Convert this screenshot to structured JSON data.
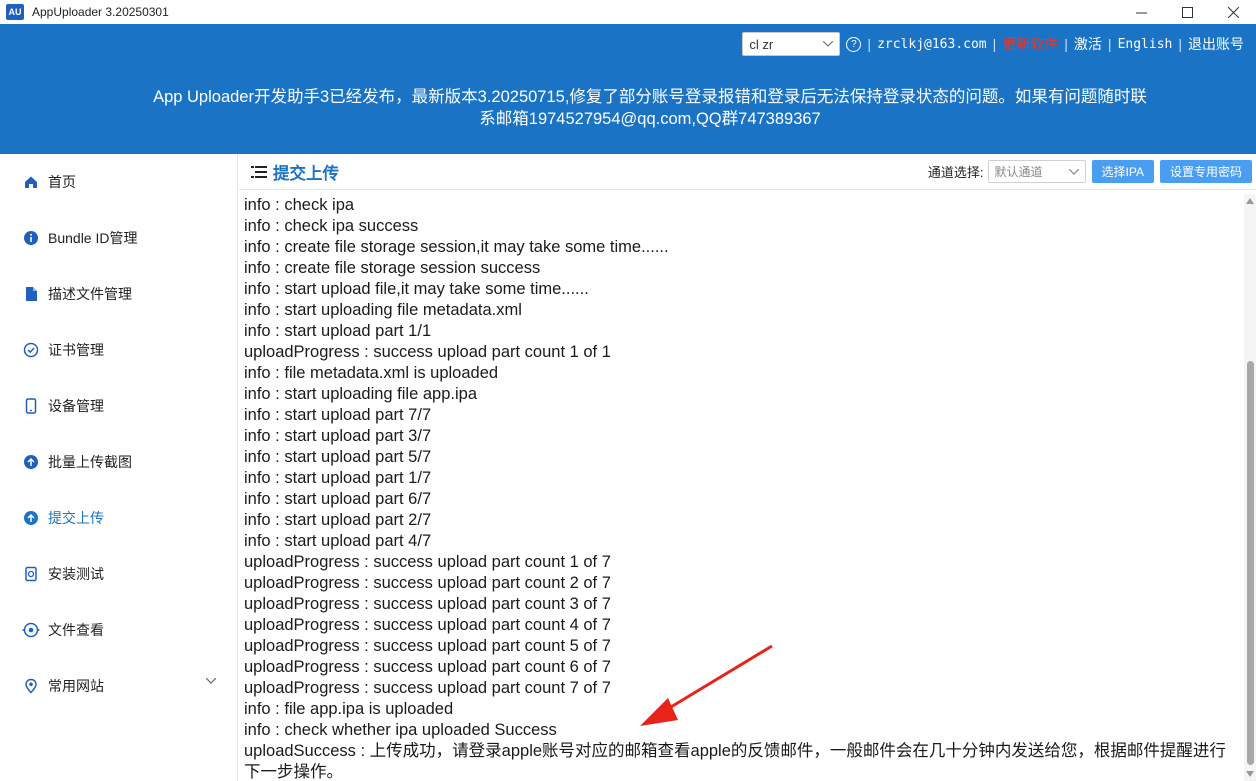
{
  "window": {
    "logo_text": "AU",
    "title": "AppUploader 3.20250301"
  },
  "header": {
    "account_select": "cl zr",
    "email": "zrclkj@163.com",
    "update_link": "更新软件",
    "activate_link": "激活",
    "language_link": "English",
    "logout_link": "退出账号",
    "announcement": "App Uploader开发助手3已经发布，最新版本3.20250715,修复了部分账号登录报错和登录后无法保持登录状态的问题。如果有问题随时联系邮箱1974527954@qq.com,QQ群747389367",
    "colors": {
      "header_bg": "#1a73c5",
      "update_link": "#e03a2f"
    }
  },
  "sidebar": {
    "items": [
      {
        "label": "首页",
        "icon": "home-icon"
      },
      {
        "label": "Bundle ID管理",
        "icon": "info-icon"
      },
      {
        "label": "描述文件管理",
        "icon": "file-icon"
      },
      {
        "label": "证书管理",
        "icon": "certificate-icon"
      },
      {
        "label": "设备管理",
        "icon": "phone-icon"
      },
      {
        "label": "批量上传截图",
        "icon": "upload-icon"
      },
      {
        "label": "提交上传",
        "icon": "upload-icon",
        "active": true
      },
      {
        "label": "安装测试",
        "icon": "install-icon"
      },
      {
        "label": "文件查看",
        "icon": "eye-icon"
      },
      {
        "label": "常用网站",
        "icon": "location-icon"
      }
    ]
  },
  "main": {
    "title": "提交上传",
    "channel_label": "通道选择:",
    "channel_value": "默认通道",
    "select_ipa_button": "选择IPA",
    "set_password_button": "设置专用密码",
    "log": [
      "info : check ipa",
      "info : check ipa success",
      "info : create file storage session,it may take some time......",
      "info : create file storage session success",
      "info : start upload file,it may take some time......",
      "info : start uploading file metadata.xml",
      "info : start upload part 1/1",
      "uploadProgress : success upload part count 1 of 1",
      "info : file metadata.xml is uploaded",
      "info : start uploading file app.ipa",
      "info : start upload part 7/7",
      "info : start upload part 3/7",
      "info : start upload part 5/7",
      "info : start upload part 1/7",
      "info : start upload part 6/7",
      "info : start upload part 2/7",
      "info : start upload part 4/7",
      "uploadProgress : success upload part count 1 of 7",
      "uploadProgress : success upload part count 2 of 7",
      "uploadProgress : success upload part count 3 of 7",
      "uploadProgress : success upload part count 4 of 7",
      "uploadProgress : success upload part count 5 of 7",
      "uploadProgress : success upload part count 6 of 7",
      "uploadProgress : success upload part count 7 of 7",
      "info : file app.ipa is uploaded",
      "info : check whether ipa uploaded Success",
      "uploadSuccess : 上传成功，请登录apple账号对应的邮箱查看apple的反馈邮件，一般邮件会在几十分钟内发送给您，根据邮件提醒进行下一步操作。"
    ]
  }
}
